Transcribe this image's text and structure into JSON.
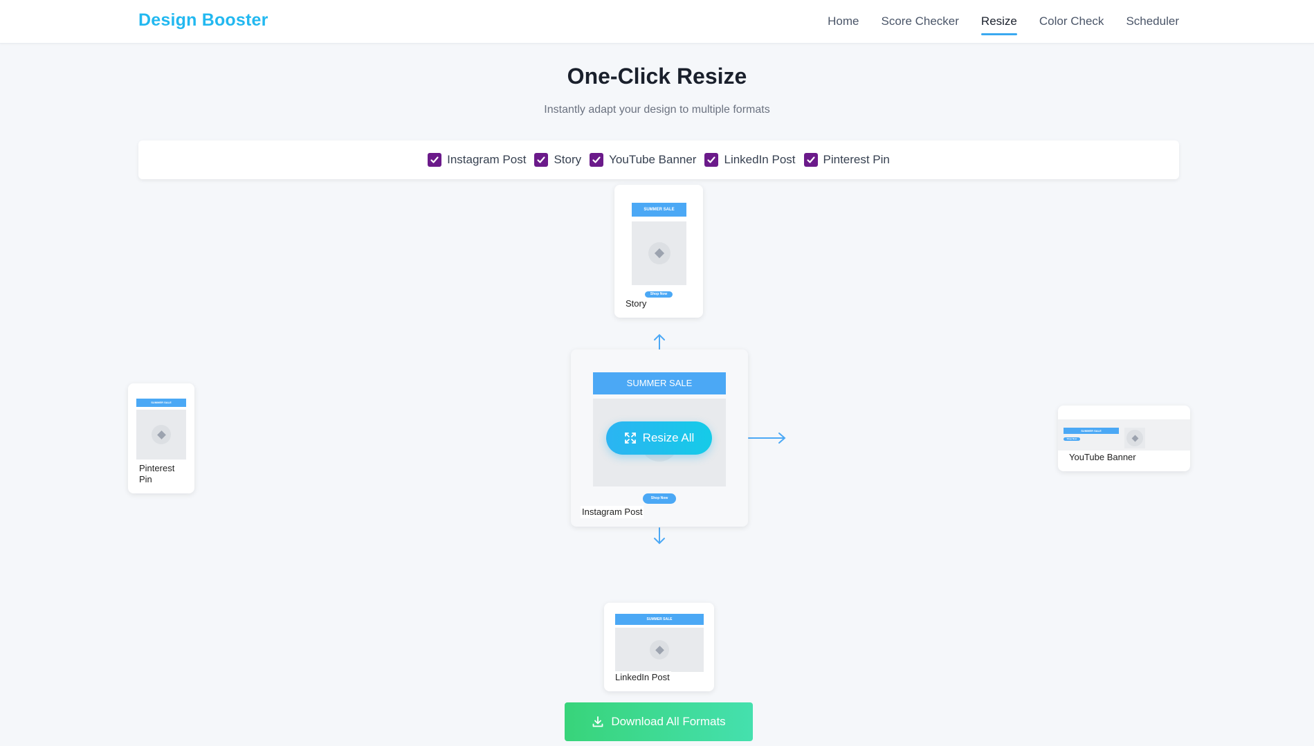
{
  "app": {
    "brand": "Design Booster"
  },
  "nav": [
    {
      "label": "Home",
      "active": false
    },
    {
      "label": "Score Checker",
      "active": false
    },
    {
      "label": "Resize",
      "active": true
    },
    {
      "label": "Color Check",
      "active": false
    },
    {
      "label": "Scheduler",
      "active": false
    }
  ],
  "page": {
    "title": "One-Click Resize",
    "subtitle": "Instantly adapt your design to multiple formats"
  },
  "formats": [
    {
      "label": "Instagram Post",
      "checked": true
    },
    {
      "label": "Story",
      "checked": true
    },
    {
      "label": "YouTube Banner",
      "checked": true
    },
    {
      "label": "LinkedIn Post",
      "checked": true
    },
    {
      "label": "Pinterest Pin",
      "checked": true
    }
  ],
  "design": {
    "banner_text": "SUMMER SALE",
    "cta_text": "Shop Now"
  },
  "cards": {
    "instagram": "Instagram Post",
    "story": "Story",
    "youtube": "YouTube Banner",
    "linkedin": "LinkedIn Post",
    "pinterest": "Pinterest Pin"
  },
  "actions": {
    "resize_all": "Resize All",
    "download_all": "Download All Formats"
  },
  "colors": {
    "brand": "#22b8f0",
    "checkbox": "#6b1a8a",
    "banner": "#4ba8f5",
    "download": "#38d47a"
  },
  "icons": {
    "resize": "expand-icon",
    "download": "download-icon",
    "checkbox": "checkmark-icon",
    "placeholder": "diamond-icon"
  }
}
